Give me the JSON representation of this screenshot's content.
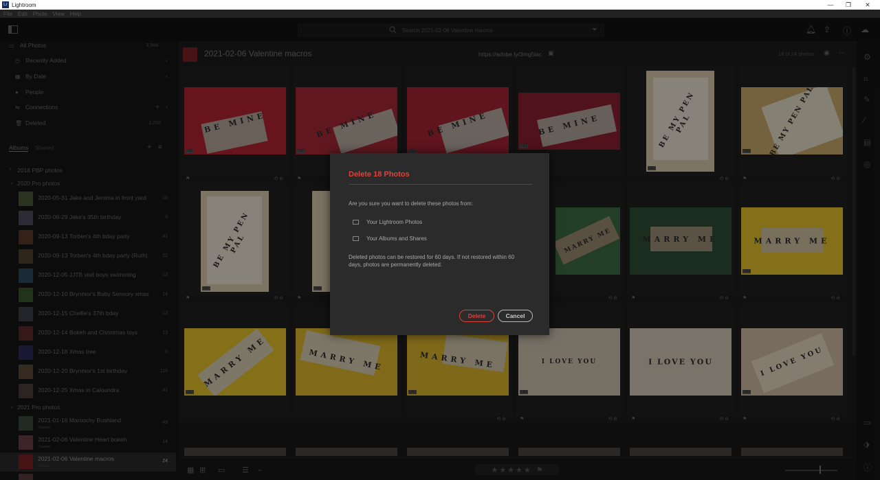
{
  "window": {
    "title": "Lightroom",
    "logo_text": "Lr",
    "controls": [
      "—",
      "❐",
      "✕"
    ]
  },
  "menu": [
    "File",
    "Edit",
    "Photo",
    "View",
    "Help"
  ],
  "toolbar": {
    "search_placeholder": "Search 2021-02-06 Valentine macros"
  },
  "sidebar": {
    "nav": [
      {
        "label": "All Photos",
        "count": "3,564",
        "icon": "photos-icon"
      },
      {
        "label": "Recently Added",
        "icon": "clock-icon"
      },
      {
        "label": "By Date",
        "icon": "calendar-icon"
      },
      {
        "label": "People",
        "icon": "person-icon"
      },
      {
        "label": "Connections",
        "icon": "connections-icon"
      },
      {
        "label": "Deleted",
        "count": "1,250",
        "icon": "trash-icon"
      }
    ],
    "tabs": {
      "albums": "Albums",
      "shared": "Shared"
    },
    "groups": [
      {
        "label": "2018 PBP photos",
        "expanded": false
      },
      {
        "label": "2020 Pro photos",
        "expanded": true
      },
      {
        "label": "2021 Pro photos",
        "expanded": true
      }
    ],
    "albums_2020": [
      {
        "name": "2020-05-31 Jake and Jemma in front yard",
        "count": "10"
      },
      {
        "name": "2020-06-29 Jake's 35th birthday",
        "count": "9"
      },
      {
        "name": "2020-09-13 Torben's 4th bday party",
        "count": "41"
      },
      {
        "name": "2020-09-13 Torben's 4th bday party (Ruth)",
        "count": "22"
      },
      {
        "name": "2020-12-05 JJTB visit boys swimming",
        "count": "12"
      },
      {
        "name": "2020-12-10 Brynmor's Baby Sensory xmas",
        "count": "14"
      },
      {
        "name": "2020-12-15 Chellie's 37th bday",
        "count": "12"
      },
      {
        "name": "2020-12-14 Bokeh and Christmas toys",
        "count": "13"
      },
      {
        "name": "2020-12-18 Xmas tree",
        "count": "5"
      },
      {
        "name": "2020-12-20 Brynmor's 1st birthday",
        "count": "110"
      },
      {
        "name": "2020-12-25 Xmas in Caloundra",
        "count": "41"
      }
    ],
    "albums_2021": [
      {
        "name": "2021-01-16 Maroochy Bushland",
        "sub": "Shared",
        "count": "49"
      },
      {
        "name": "2021-02-06 Valentine Heart bokeh",
        "sub": "Shared",
        "count": "14"
      },
      {
        "name": "2021-02-06 Valentine macros",
        "sub": "Shared",
        "count": "24"
      }
    ]
  },
  "main": {
    "title": "2021-02-06 Valentine macros",
    "link": "https://adobe.ly/3mg5lac",
    "photo_count": "18 of 24 photos",
    "badge": "CR2",
    "tiles": [
      "BE MINE",
      "BE MINE",
      "BE MINE",
      "BE MINE",
      "BE MY PEN PAL",
      "BE MY PEN PAL",
      "BE MY PEN PAL",
      "BE MY PEN PAL",
      "",
      "",
      "MARRY ME",
      "MARRY ME",
      "MARRY ME",
      "MARRY ME",
      "MARRY ME",
      "MARRY ME",
      "I LOVE YOU",
      "I LOVE YOU"
    ],
    "rating": "★★★★★",
    "flag_icon": "⚑",
    "cell_icons": "⟲ ⊘"
  },
  "dialog": {
    "title": "Delete 18 Photos",
    "question": "Are you sure you want to delete these photos from:",
    "options": [
      "Your Lightroom Photos",
      "Your Albums and Shares"
    ],
    "note": "Deleted photos can be restored for 60 days. If not restored within 60 days, photos are permanently deleted.",
    "delete_label": "Delete",
    "cancel_label": "Cancel"
  },
  "colors": {
    "accent": "#e0413a",
    "rose": "#b32433",
    "yellow": "#e3c22a",
    "leaf": "#3d6b44",
    "cream": "#d9c8ac"
  }
}
